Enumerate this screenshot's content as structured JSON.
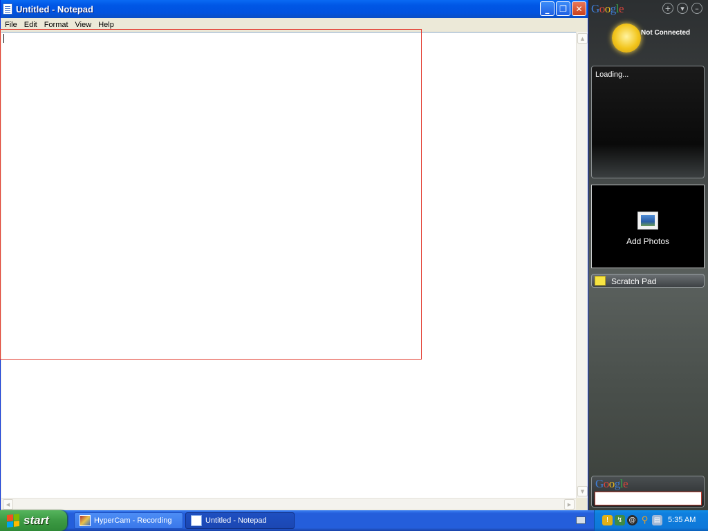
{
  "notepad": {
    "title": "Untitled - Notepad",
    "menu": [
      "File",
      "Edit",
      "Format",
      "View",
      "Help"
    ],
    "content": "",
    "buttons": {
      "minimize": "_",
      "restore": "❐",
      "close": "✕"
    }
  },
  "sidebar": {
    "logo_letters": [
      "G",
      "o",
      "o",
      "g",
      "l",
      "e"
    ],
    "controls": {
      "add": "+",
      "options": "▾",
      "minimize": "–"
    },
    "weather": {
      "status": "Not Connected"
    },
    "news": {
      "status": "Loading..."
    },
    "photos": {
      "label": "Add Photos"
    },
    "scratch_pad": {
      "label": "Scratch Pad"
    },
    "search": {
      "logo_letters": [
        "G",
        "o",
        "o",
        "g",
        "l",
        "e"
      ],
      "value": ""
    }
  },
  "taskbar": {
    "start_label": "start",
    "tasks": [
      {
        "label": "HyperCam - Recording",
        "active": false
      },
      {
        "label": "Untitled - Notepad",
        "active": true
      }
    ],
    "tray_icons": [
      "shield-icon",
      "network-icon",
      "swirl-icon",
      "search-icon",
      "computer-icon"
    ],
    "clock": "5:35 AM"
  },
  "colors": {
    "title_bar": "#0054e3",
    "taskbar": "#245edb",
    "start_button": "#3c9a43",
    "selection_rectangle": "#e23a2e"
  }
}
